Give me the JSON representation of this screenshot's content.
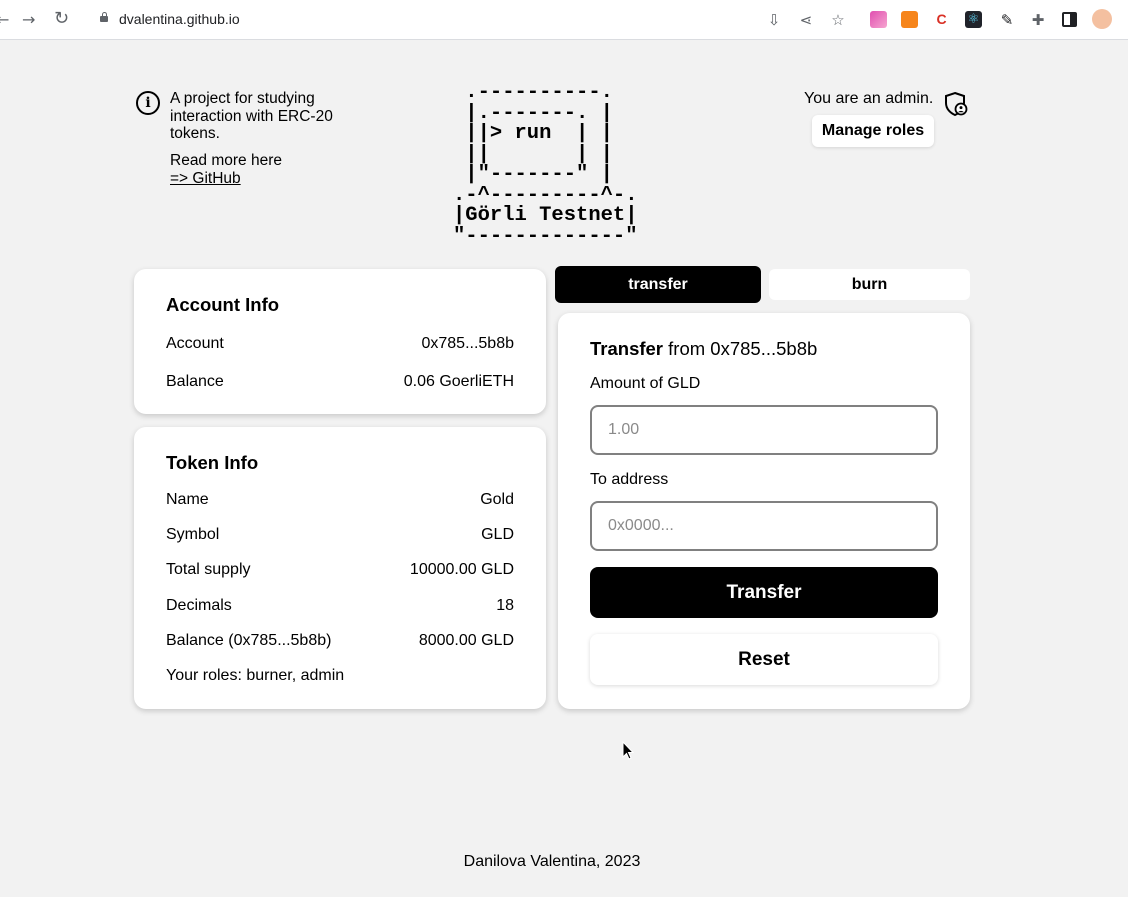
{
  "browser": {
    "url": "dvalentina.github.io",
    "back_icon": "back-arrow-icon",
    "forward_icon": "forward-arrow-icon",
    "reload_icon": "reload-icon"
  },
  "header": {
    "about": "A project for studying interaction with ERC-20 tokens.",
    "read_more": "Read more here",
    "github_link": "=> GitHub",
    "network_ascii": " .----------.\n |.-------. |\n ||> run  | |\n ||       | |\n |\"-------\" |\n.-^---------^-.\n|Görli Testnet|\n\"-------------\"",
    "admin_text": "You are an admin.",
    "manage_roles": "Manage roles"
  },
  "account_info": {
    "title": "Account Info",
    "rows": [
      {
        "label": "Account",
        "value": "0x785...5b8b"
      },
      {
        "label": "Balance",
        "value": "0.06 GoerliETH"
      }
    ]
  },
  "token_info": {
    "title": "Token Info",
    "rows": [
      {
        "label": "Name",
        "value": "Gold"
      },
      {
        "label": "Symbol",
        "value": "GLD"
      },
      {
        "label": "Total supply",
        "value": "10000.00 GLD"
      },
      {
        "label": "Decimals",
        "value": "18"
      },
      {
        "label": "Balance (0x785...5b8b)",
        "value": "8000.00 GLD"
      }
    ],
    "roles": "Your roles: burner, admin"
  },
  "tabs": [
    {
      "label": "transfer",
      "active": true
    },
    {
      "label": "burn",
      "active": false
    }
  ],
  "transfer_form": {
    "title_bold": "Transfer",
    "title_rest": " from 0x785...5b8b",
    "amount_label": "Amount of GLD",
    "amount_placeholder": "1.00",
    "address_label": "To address",
    "address_placeholder": "0x0000...",
    "submit": "Transfer",
    "reset": "Reset"
  },
  "footer": "Danilova Valentina, 2023",
  "colors": {
    "page_bg": "#f2f2f2",
    "accent": "#000000",
    "card_bg": "#ffffff"
  }
}
